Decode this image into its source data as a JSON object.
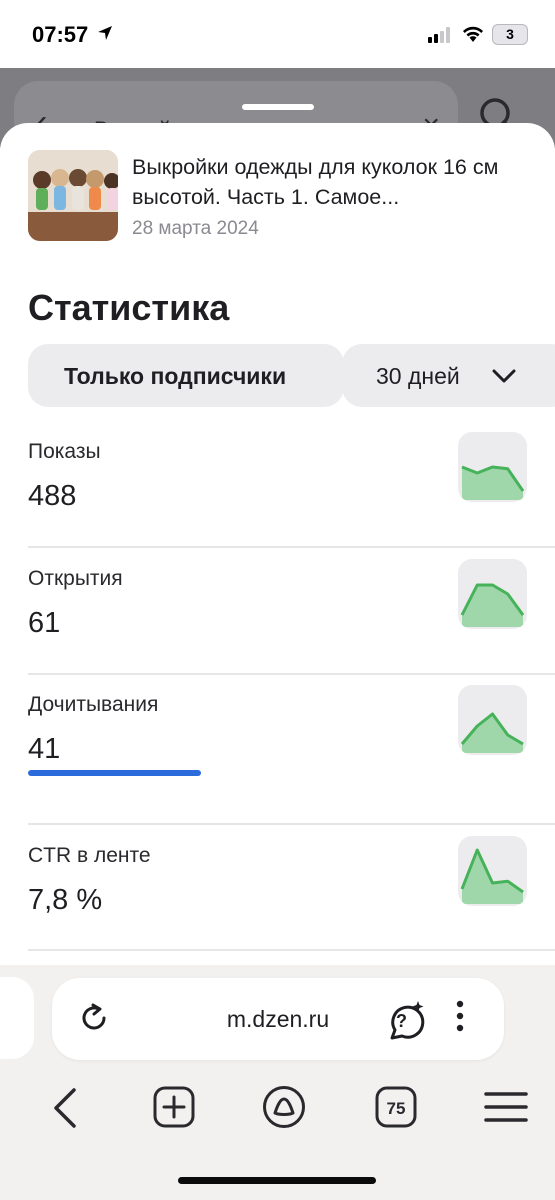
{
  "status_bar": {
    "time": "07:57",
    "battery": "3"
  },
  "background_page": {
    "search_text": "Выкройки"
  },
  "article": {
    "title": "Выкройки одежды для куколок 16 см высотой. Часть 1. Самое...",
    "date": "28 марта 2024"
  },
  "stats": {
    "title": "Статистика",
    "filter_audience": "Только подписчики",
    "filter_period": "30 дней",
    "metrics": [
      {
        "label": "Показы",
        "value": "488",
        "trend": [
          0.55,
          0.45,
          0.55,
          0.52,
          0.15
        ]
      },
      {
        "label": "Открытия",
        "value": "61",
        "trend": [
          0.2,
          0.7,
          0.7,
          0.55,
          0.2
        ]
      },
      {
        "label": "Дочитывания",
        "value": "41",
        "trend": [
          0.15,
          0.45,
          0.65,
          0.3,
          0.15
        ]
      },
      {
        "label": "CTR в ленте",
        "value": "7,8 %",
        "trend": [
          0.25,
          0.9,
          0.35,
          0.38,
          0.2
        ]
      }
    ]
  },
  "browser": {
    "url": "m.dzen.ru",
    "tabs_count": "75"
  },
  "colors": {
    "accent": "#2b6bdc",
    "spark_fill": "#9fd7ab",
    "spark_line": "#46b25a"
  }
}
